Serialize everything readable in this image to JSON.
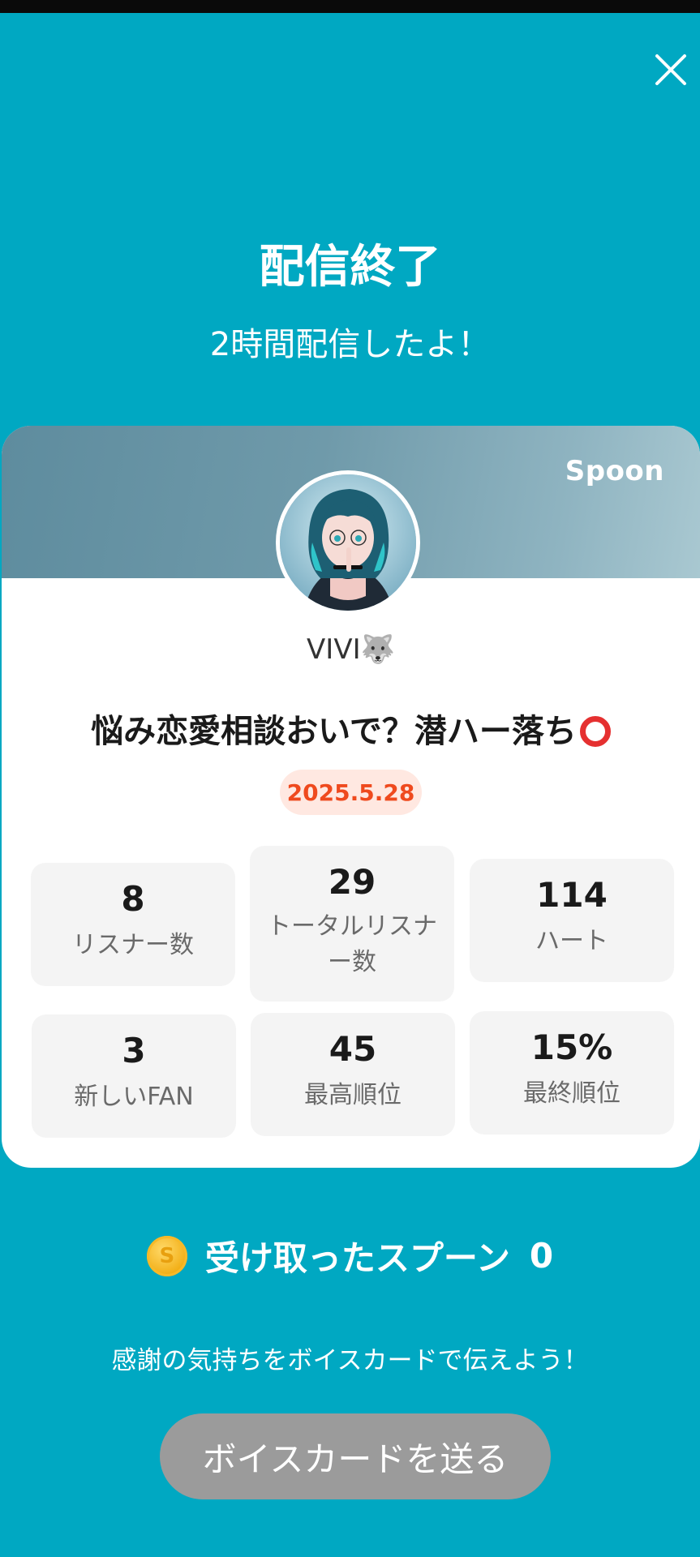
{
  "header": {
    "title": "配信終了",
    "subtitle": "2時間配信したよ！"
  },
  "card": {
    "brand": "Spoon",
    "username": "VIVI",
    "username_emoji": "🐺",
    "stream_title": "悩み恋愛相談おいで？潜ハー落ち",
    "date": "2025.5.28",
    "stats": [
      {
        "value": "8",
        "label": "リスナー数"
      },
      {
        "value": "29",
        "label_line1": "トータルリスナ",
        "label_line2": "ー数"
      },
      {
        "value": "114",
        "label": "ハート"
      },
      {
        "value": "3",
        "label": "新しいFAN"
      },
      {
        "value": "45",
        "label": "最高順位"
      },
      {
        "value": "15%",
        "label": "最終順位"
      }
    ]
  },
  "spoons": {
    "label": "受け取ったスプーン",
    "count": "0",
    "coin_symbol": "S"
  },
  "voice_card": {
    "message": "感謝の気持ちをボイスカードで伝えよう！",
    "button_label": "ボイスカードを送る"
  },
  "colors": {
    "background": "#00a8c2",
    "date_text": "#ef4a1e",
    "date_bg": "#ffe8e1",
    "button_bg": "#9b9b9b"
  },
  "icons": {
    "close": "close-icon",
    "coin": "spoon-coin-icon",
    "title_mark": "red-circle-icon"
  }
}
